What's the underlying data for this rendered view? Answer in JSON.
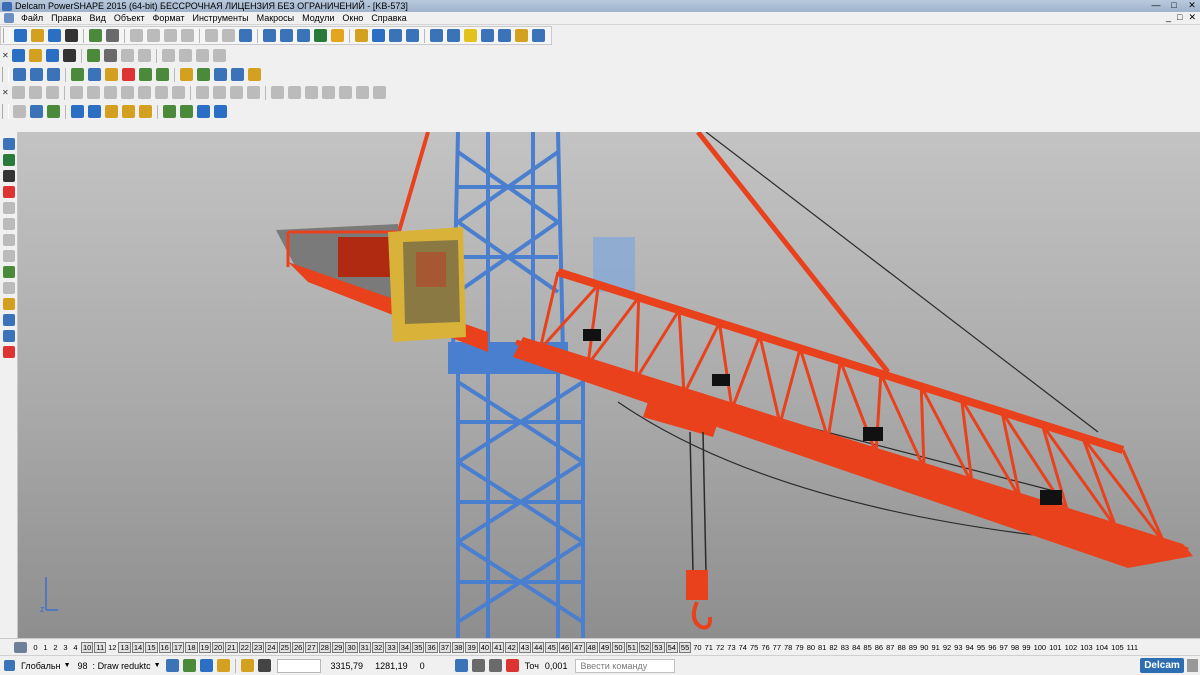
{
  "window": {
    "title": "Delcam PowerSHAPE 2015 (64-bit) БЕССРОЧНАЯ ЛИЦЕНЗИЯ БЕЗ ОГРАНИЧЕНИЙ - [KB-573]",
    "min": "—",
    "restore": "□",
    "close": "✕"
  },
  "menu": [
    "Файл",
    "Правка",
    "Вид",
    "Объект",
    "Формат",
    "Инструменты",
    "Макросы",
    "Модули",
    "Окно",
    "Справка"
  ],
  "mdi_controls": {
    "min": "_",
    "restore": "□",
    "close": "✕"
  },
  "toolbar_icon_colors": {
    "row1": [
      "#2a6fc4",
      "#d4a020",
      "#2a6fc4",
      "#333",
      "#4a8a3a",
      "#6a6a6a",
      "#bbb",
      "#bbb",
      "#bbb",
      "#bbb",
      "#bbb",
      "#bbb",
      "#3a73b8",
      "#3a73b8",
      "#3a73b8",
      "#3a73b8",
      "#2a7a3a",
      "#e3a51e",
      "#d4a020",
      "#2a6fc4",
      "#3a73b8",
      "#3a73b8",
      "#3a73b8",
      "#3a73b8",
      "#e3c21e",
      "#3a73b8",
      "#3a73b8",
      "#d4a020",
      "#3a73b8"
    ],
    "row2": [
      "#3a73b8",
      "#3a73b8",
      "#3a73b8",
      "#4a8a3a",
      "#3a73b8",
      "#d4a020",
      "#d33",
      "#4a8a3a",
      "#4a8a3a",
      "#d4a020",
      "#4a8a3a",
      "#3a73b8",
      "#3a73b8",
      "#d4a020"
    ],
    "row3": [
      "#bbb",
      "#bbb",
      "#bbb",
      "#bbb",
      "#bbb",
      "#bbb",
      "#bbb",
      "#bbb",
      "#bbb",
      "#bbb",
      "#bbb",
      "#bbb",
      "#bbb",
      "#bbb",
      "#bbb",
      "#bbb",
      "#bbb",
      "#bbb",
      "#bbb",
      "#bbb",
      "#bbb"
    ],
    "row4": [
      "#bbb",
      "#3a73b8",
      "#4a8a3a",
      "#2a6fc4",
      "#2a6fc4",
      "#d4a020",
      "#d4a020",
      "#d4a020",
      "#4a8a3a",
      "#4a8a3a",
      "#2a6fc4",
      "#2a6fc4"
    ],
    "left": [
      "#3a73b8",
      "#2a7a3a",
      "#333",
      "#d33",
      "#bbb",
      "#bbb",
      "#bbb",
      "#bbb",
      "#4a8a3a",
      "#bbb",
      "#d4a020",
      "#3a73b8",
      "#3a73b8",
      "#d33"
    ]
  },
  "levels": [
    {
      "n": "0",
      "on": false
    },
    {
      "n": "1",
      "on": false
    },
    {
      "n": "2",
      "on": false
    },
    {
      "n": "3",
      "on": false
    },
    {
      "n": "4",
      "on": false
    },
    {
      "n": "10",
      "on": true
    },
    {
      "n": "11",
      "on": true
    },
    {
      "n": "12",
      "on": false
    },
    {
      "n": "13",
      "on": true
    },
    {
      "n": "14",
      "on": true
    },
    {
      "n": "15",
      "on": true
    },
    {
      "n": "16",
      "on": true
    },
    {
      "n": "17",
      "on": true
    },
    {
      "n": "18",
      "on": true
    },
    {
      "n": "19",
      "on": true
    },
    {
      "n": "20",
      "on": true
    },
    {
      "n": "21",
      "on": true
    },
    {
      "n": "22",
      "on": true
    },
    {
      "n": "23",
      "on": true
    },
    {
      "n": "24",
      "on": true
    },
    {
      "n": "25",
      "on": true
    },
    {
      "n": "26",
      "on": true
    },
    {
      "n": "27",
      "on": true
    },
    {
      "n": "28",
      "on": true
    },
    {
      "n": "29",
      "on": true
    },
    {
      "n": "30",
      "on": true
    },
    {
      "n": "31",
      "on": true
    },
    {
      "n": "32",
      "on": true
    },
    {
      "n": "33",
      "on": true
    },
    {
      "n": "34",
      "on": true
    },
    {
      "n": "35",
      "on": true
    },
    {
      "n": "36",
      "on": true
    },
    {
      "n": "37",
      "on": true
    },
    {
      "n": "38",
      "on": true
    },
    {
      "n": "39",
      "on": true
    },
    {
      "n": "40",
      "on": true
    },
    {
      "n": "41",
      "on": true
    },
    {
      "n": "42",
      "on": true
    },
    {
      "n": "43",
      "on": true
    },
    {
      "n": "44",
      "on": true
    },
    {
      "n": "45",
      "on": true
    },
    {
      "n": "46",
      "on": true
    },
    {
      "n": "47",
      "on": true
    },
    {
      "n": "48",
      "on": true
    },
    {
      "n": "49",
      "on": true
    },
    {
      "n": "50",
      "on": true
    },
    {
      "n": "51",
      "on": true
    },
    {
      "n": "52",
      "on": true
    },
    {
      "n": "53",
      "on": true
    },
    {
      "n": "54",
      "on": true
    },
    {
      "n": "55",
      "on": true
    },
    {
      "n": "70",
      "on": false
    },
    {
      "n": "71",
      "on": false
    },
    {
      "n": "72",
      "on": false
    },
    {
      "n": "73",
      "on": false
    },
    {
      "n": "74",
      "on": false
    },
    {
      "n": "75",
      "on": false
    },
    {
      "n": "76",
      "on": false
    },
    {
      "n": "77",
      "on": false
    },
    {
      "n": "78",
      "on": false
    },
    {
      "n": "79",
      "on": false
    },
    {
      "n": "80",
      "on": false
    },
    {
      "n": "81",
      "on": false
    },
    {
      "n": "82",
      "on": false
    },
    {
      "n": "83",
      "on": false
    },
    {
      "n": "84",
      "on": false
    },
    {
      "n": "85",
      "on": false
    },
    {
      "n": "86",
      "on": false
    },
    {
      "n": "87",
      "on": false
    },
    {
      "n": "88",
      "on": false
    },
    {
      "n": "89",
      "on": false
    },
    {
      "n": "90",
      "on": false
    },
    {
      "n": "91",
      "on": false
    },
    {
      "n": "92",
      "on": false
    },
    {
      "n": "93",
      "on": false
    },
    {
      "n": "94",
      "on": false
    },
    {
      "n": "95",
      "on": false
    },
    {
      "n": "96",
      "on": false
    },
    {
      "n": "97",
      "on": false
    },
    {
      "n": "98",
      "on": false
    },
    {
      "n": "99",
      "on": false
    },
    {
      "n": "100",
      "on": false
    },
    {
      "n": "101",
      "on": false
    },
    {
      "n": "102",
      "on": false
    },
    {
      "n": "103",
      "on": false
    },
    {
      "n": "104",
      "on": false
    },
    {
      "n": "105",
      "on": false
    },
    {
      "n": "111",
      "on": false
    }
  ],
  "status": {
    "workplane": "Глобальн",
    "level_num": "98",
    "level_name": "Draw reduktc",
    "coord_x": "3315,79",
    "coord_y": "1281,19",
    "coord_z": "0",
    "tolerance_label": "Точ",
    "tolerance_value": "0,001",
    "command_placeholder": "Ввести команду",
    "logo": "Delcam"
  },
  "colors": {
    "crane_red": "#e8411c",
    "crane_blue": "#4a7fd0",
    "cab_yellow": "#d9b23a"
  }
}
